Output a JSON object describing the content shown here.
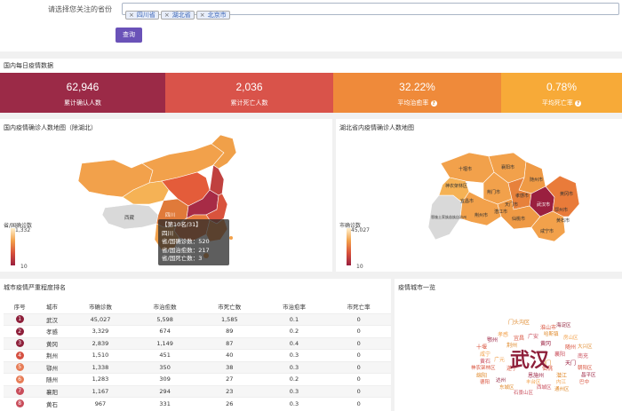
{
  "filter": {
    "label": "请选择您关注的省份",
    "tags": [
      "四川省",
      "湖北省",
      "北京市"
    ],
    "remove_glyph": "×",
    "query_label": "查询"
  },
  "daily": {
    "title": "国内每日疫情数据",
    "stats": [
      {
        "value": "62,946",
        "label": "累计确认人数",
        "color": "#9b2a47"
      },
      {
        "value": "2,036",
        "label": "累计死亡人数",
        "color": "#d9534a"
      },
      {
        "value": "32.22%",
        "label": "平均治愈率",
        "color": "#ef8a3a",
        "has_help": true
      },
      {
        "value": "0.78%",
        "label": "平均死亡率",
        "color": "#f7aa38",
        "has_help": true
      }
    ]
  },
  "china_map": {
    "title": "国内疫情确诊人数地图（除湖北）",
    "legend_title": "省/国确诊数",
    "legend_max": "1,332",
    "legend_min": "10",
    "region_labels": [
      "四川",
      "西藏"
    ],
    "tooltip": {
      "line1": "【第10名/31】",
      "line2": "四川",
      "line3": "省/国确诊数：520",
      "line4": "省/国治愈数：217",
      "line5": "省/国死亡数：3"
    }
  },
  "hubei_map": {
    "title": "湖北省内疫情确诊人数地图",
    "legend_title": "市确诊数",
    "legend_max": "45,027",
    "legend_min": "10",
    "city_labels": [
      "十堰市",
      "神农架林区",
      "襄阳市",
      "随州市",
      "孝感市",
      "宜昌市",
      "荆门市",
      "武汉市",
      "恩施土家族苗族自治州",
      "荆州市",
      "潜江市",
      "天门市",
      "仙桃市",
      "黄冈市",
      "鄂州市",
      "黄石市",
      "咸宁市"
    ]
  },
  "ranking": {
    "title": "城市疫情严重程度排名",
    "headers": [
      "序号",
      "城市",
      "市确诊数",
      "市治愈数",
      "市死亡数",
      "市治愈率",
      "市死亡率"
    ],
    "rows": [
      [
        "1",
        "武汉",
        "45,027",
        "5,598",
        "1,585",
        "0.1",
        "0"
      ],
      [
        "2",
        "孝感",
        "3,329",
        "674",
        "89",
        "0.2",
        "0"
      ],
      [
        "3",
        "黄冈",
        "2,839",
        "1,149",
        "87",
        "0.4",
        "0"
      ],
      [
        "4",
        "荆州",
        "1,510",
        "451",
        "40",
        "0.3",
        "0"
      ],
      [
        "5",
        "鄂州",
        "1,338",
        "350",
        "38",
        "0.3",
        "0"
      ],
      [
        "6",
        "随州",
        "1,283",
        "309",
        "27",
        "0.2",
        "0"
      ],
      [
        "7",
        "襄阳",
        "1,167",
        "294",
        "23",
        "0.3",
        "0"
      ],
      [
        "8",
        "黄石",
        "967",
        "331",
        "26",
        "0.3",
        "0"
      ]
    ]
  },
  "cloud": {
    "title": "疫情城市一览",
    "big_word": "武汉",
    "words": [
      "门头沟区",
      "淮山市",
      "海淀区",
      "哈斯镇",
      "广安",
      "孝感",
      "宜昌",
      "房山区",
      "鄂州",
      "随州",
      "黄冈",
      "荆州",
      "十堰",
      "襄阳",
      "咸宁",
      "神农架林区",
      "荆门",
      "天门",
      "仙桃",
      "潜江",
      "黄石",
      "恩施州",
      "广元",
      "绵阳",
      "遂宁",
      "南充",
      "达州",
      "朝阳区",
      "丰台区",
      "大兴区",
      "西城区",
      "东城区",
      "昌平区",
      "巴中",
      "内江",
      "石景山区",
      "通州区",
      "德阳"
    ]
  },
  "colors": {
    "accent_purple": "#6a52b8",
    "map_dark": "#9a1f3f",
    "map_orange": "#f2a14b",
    "map_light": "#fbe6b5",
    "map_gray": "#d9d9d9"
  }
}
